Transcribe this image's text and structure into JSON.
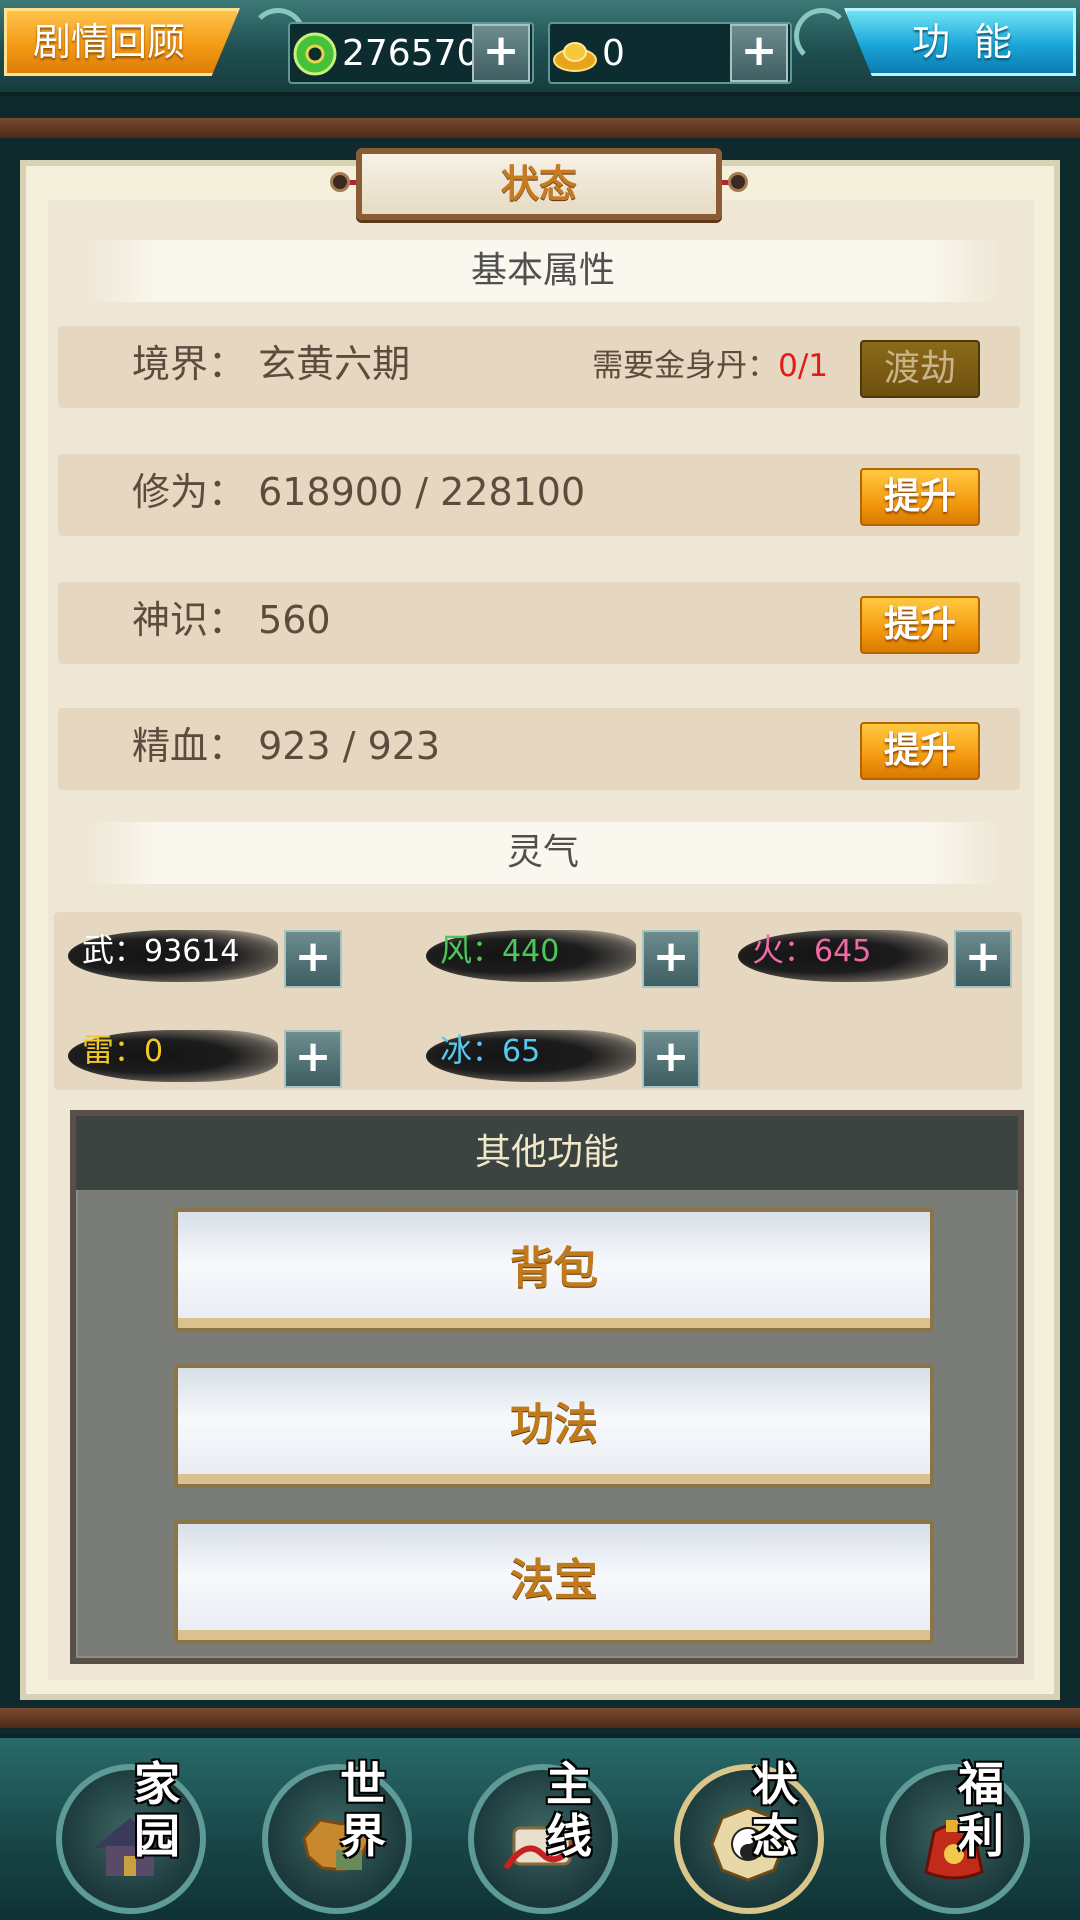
{
  "topbar": {
    "story_label": "剧情回顾",
    "function_label": "功能",
    "spirit_stones": "276570",
    "gold_ingots": "0"
  },
  "panel": {
    "title": "状态",
    "basic_section": "基本属性",
    "realm": {
      "label": "境界：  玄黄六期",
      "need_label": "需要金身丹：",
      "need_value": "0/1",
      "button": "渡劫"
    },
    "cultivation": {
      "label": "修为：  618900 / 228100",
      "button": "提升"
    },
    "divine_sense": {
      "label": "神识：  560",
      "button": "提升"
    },
    "essence_blood": {
      "label": "精血：  923 / 923",
      "button": "提升"
    },
    "spirit_section": "灵气",
    "spirits": [
      {
        "key": "武",
        "value": "93614",
        "color": "#ffffff"
      },
      {
        "key": "风",
        "value": "440",
        "color": "#4cc85a"
      },
      {
        "key": "火",
        "value": "645",
        "color": "#f06aa6"
      },
      {
        "key": "雷",
        "value": "0",
        "color": "#f0c82a"
      },
      {
        "key": "冰",
        "value": "65",
        "color": "#58c8f0"
      }
    ]
  },
  "other": {
    "title": "其他功能",
    "buttons": [
      "背包",
      "功法",
      "法宝"
    ]
  },
  "bottomnav": [
    {
      "label": "家园",
      "icon": "home-icon"
    },
    {
      "label": "世界",
      "icon": "world-map-icon"
    },
    {
      "label": "主线",
      "icon": "main-quest-scroll-icon"
    },
    {
      "label": "状态",
      "icon": "bagua-status-icon"
    },
    {
      "label": "福利",
      "icon": "gift-bag-icon"
    }
  ],
  "colors": {
    "accent_orange": "#f49b15",
    "accent_cyan": "#1ba6d8",
    "need_red": "#e41a1a"
  }
}
